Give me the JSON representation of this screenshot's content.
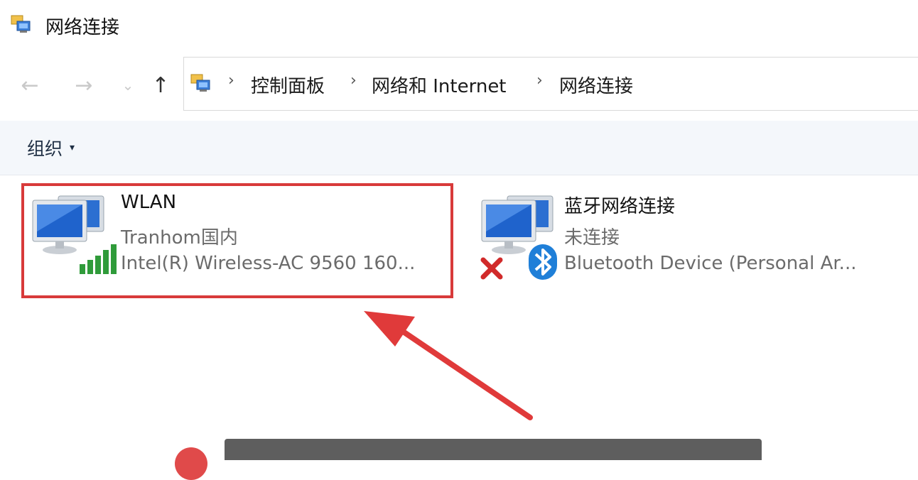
{
  "window": {
    "title": "网络连接"
  },
  "nav": {
    "back_icon": "←",
    "forward_icon": "→",
    "recent_icon": "⌄",
    "up_icon": "↑"
  },
  "breadcrumb": [
    {
      "label": "控制面板"
    },
    {
      "label": "网络和 Internet"
    },
    {
      "label": "网络连接"
    }
  ],
  "breadcrumb_separator": "›",
  "toolbar": {
    "organize_label": "组织",
    "organize_caret": "▾"
  },
  "connections": [
    {
      "name": "WLAN",
      "network": "Tranhom国内",
      "adapter": "Intel(R) Wireless-AC 9560 160...",
      "icon": "wifi-signal-icon",
      "highlighted": true
    },
    {
      "name": "蓝牙网络连接",
      "network": "未连接",
      "adapter": "Bluetooth Device (Personal Ar...",
      "icon": "bluetooth-icon",
      "status": "disconnected"
    }
  ],
  "colors": {
    "highlight": "#d83a3a",
    "annotation_arrow": "#e03a3a",
    "signal_green": "#2f9b3a",
    "bluetooth_blue": "#1f7fd8",
    "disconnect_red": "#d12a2a"
  }
}
